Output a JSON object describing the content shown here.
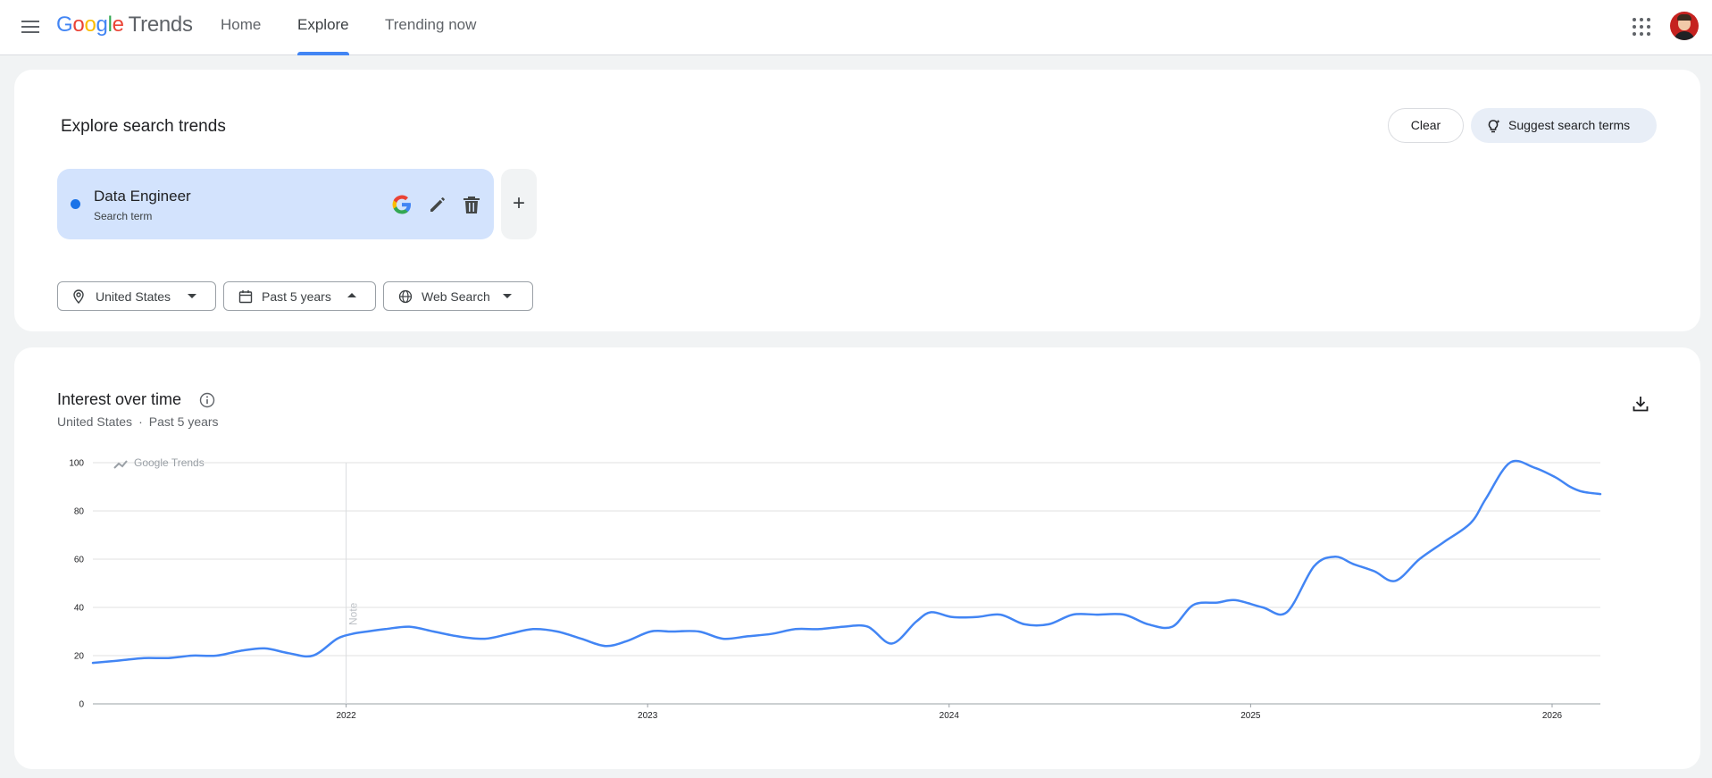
{
  "header": {
    "logo_google": [
      "G",
      "o",
      "o",
      "g",
      "l",
      "e"
    ],
    "logo_trends": "Trends",
    "tabs": [
      {
        "label": "Home",
        "active": false
      },
      {
        "label": "Explore",
        "active": true
      },
      {
        "label": "Trending now",
        "active": false
      }
    ],
    "menu_icon": "hamburger-menu-icon",
    "apps_icon": "google-apps-icon",
    "avatar": "user-avatar"
  },
  "explore": {
    "title": "Explore search trends",
    "clear_label": "Clear",
    "suggest_label": "Suggest search terms",
    "term": {
      "name": "Data Engineer",
      "type": "Search term",
      "dot_color": "#1a73e8"
    },
    "add_icon": "+",
    "filters": {
      "location": "United States",
      "time": "Past 5 years",
      "property": "Web Search"
    }
  },
  "interest": {
    "title": "Interest over time",
    "subtitle_location": "United States",
    "subtitle_separator": "·",
    "subtitle_time": "Past 5 years"
  },
  "chart_data": {
    "type": "line",
    "title": "",
    "watermark": "Google Trends",
    "note_label": "Note",
    "note_at_year": 2022.0,
    "xlabel": "",
    "ylabel": "",
    "ylim": [
      0,
      100
    ],
    "xlim": [
      2021.16,
      2026.16
    ],
    "yticks": [
      "0",
      "20",
      "40",
      "60",
      "80",
      "100"
    ],
    "xticks": [
      {
        "label": "2022",
        "x": 2022.0
      },
      {
        "label": "2023",
        "x": 2023.0
      },
      {
        "label": "2024",
        "x": 2024.0
      },
      {
        "label": "2025",
        "x": 2025.0
      },
      {
        "label": "2026",
        "x": 2026.0
      }
    ],
    "grid": true,
    "line_color": "#4285f4",
    "series": [
      {
        "x": [
          2021.16,
          2021.25,
          2021.33,
          2021.41,
          2021.49,
          2021.57,
          2021.65,
          2021.73,
          2021.81,
          2021.89,
          2021.97,
          2022.02,
          2022.07,
          2022.13,
          2022.21,
          2022.29,
          2022.37,
          2022.46,
          2022.54,
          2022.62,
          2022.7,
          2022.78,
          2022.86,
          2022.93,
          2023.01,
          2023.08,
          2023.17,
          2023.25,
          2023.33,
          2023.41,
          2023.49,
          2023.57,
          2023.65,
          2023.73,
          2023.81,
          2023.89,
          2023.94,
          2024.01,
          2024.09,
          2024.17,
          2024.25,
          2024.33,
          2024.41,
          2024.49,
          2024.58,
          2024.66,
          2024.74,
          2024.81,
          2024.89,
          2024.95,
          2025.04,
          2025.12,
          2025.21,
          2025.28,
          2025.34,
          2025.41,
          2025.48,
          2025.56,
          2025.64,
          2025.73,
          2025.78,
          2025.86,
          2025.94,
          2026.01,
          2026.06,
          2026.1,
          2026.16
        ],
        "y": [
          17,
          18,
          19,
          19,
          20,
          20,
          22,
          23,
          21,
          20,
          27,
          29,
          30,
          31,
          32,
          30,
          28,
          27,
          29,
          31,
          30,
          27,
          24,
          26,
          30,
          30,
          30,
          27,
          28,
          29,
          31,
          31,
          32,
          32,
          25,
          34,
          38,
          36,
          36,
          37,
          33,
          33,
          37,
          37,
          37,
          33,
          32,
          41,
          42,
          43,
          40,
          38,
          57,
          61,
          58,
          55,
          51,
          60,
          67,
          75,
          85,
          100,
          98,
          94,
          90,
          88,
          87
        ],
        "name": ""
      }
    ]
  }
}
